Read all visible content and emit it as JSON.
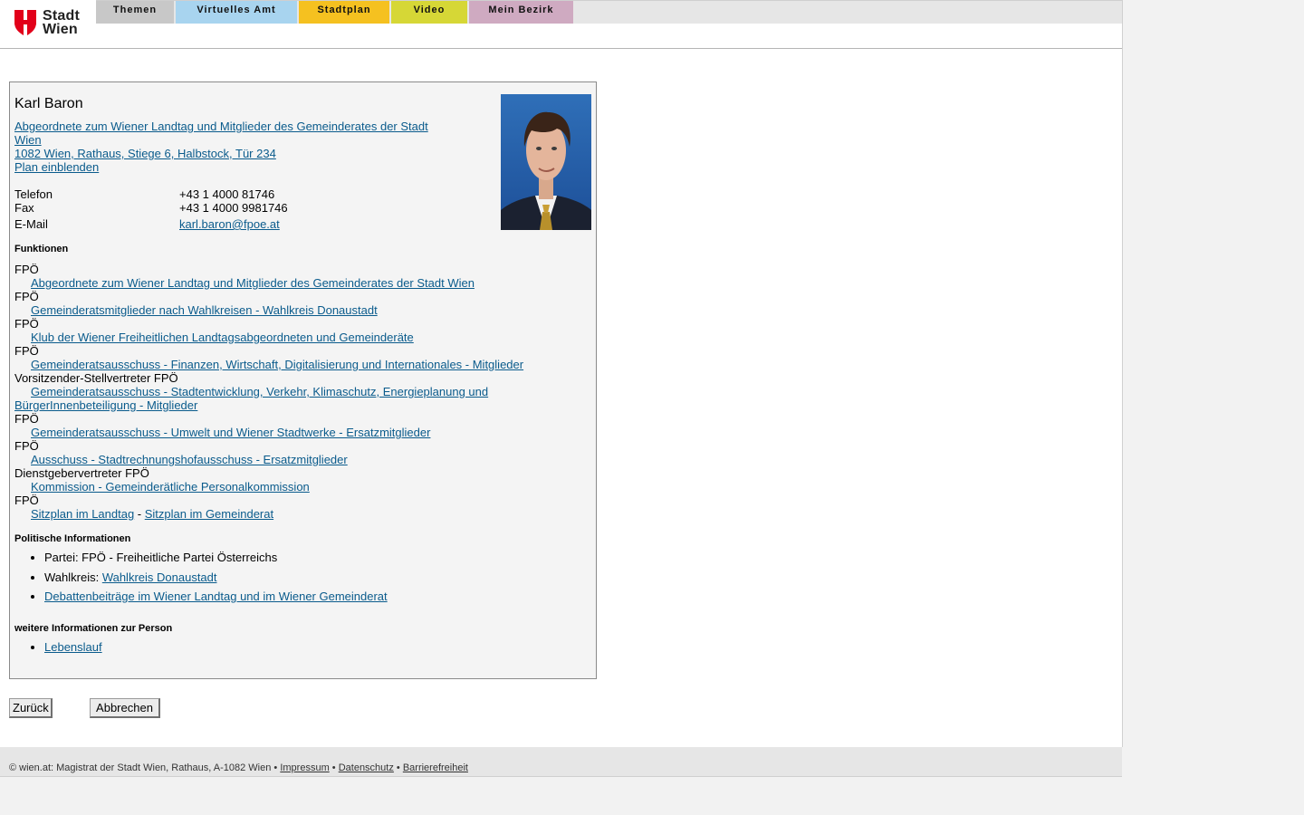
{
  "logo": {
    "line1": "Stadt",
    "line2": "Wien",
    "colors": {
      "red": "#e2001a"
    }
  },
  "nav": {
    "tabs": [
      {
        "label": "Themen",
        "color": "#c8c8c8"
      },
      {
        "label": "Virtuelles Amt",
        "color": "#a8d4ef"
      },
      {
        "label": "Stadtplan",
        "color": "#f5c120"
      },
      {
        "label": "Video",
        "color": "#d6d736"
      },
      {
        "label": "Mein Bezirk",
        "color": "#cfaac1"
      }
    ]
  },
  "person": {
    "name": "Karl Baron",
    "role_line1": "Abgeordnete zum Wiener Landtag und Mitglieder des Gemeinderates der Stadt",
    "role_line2": "Wien ",
    "address": "1082 Wien, Rathaus, Stiege 6, Halbstock, Tür 234",
    "plan": "Plan einblenden",
    "contact": [
      {
        "label": "Telefon",
        "value": "+43 1 4000 81746"
      },
      {
        "label": "Fax",
        "value": "+43 1 4000 9981746"
      },
      {
        "label": "E-Mail",
        "value": "karl.baron@fpoe.at"
      }
    ]
  },
  "funktionen": {
    "heading": "Funktionen",
    "items": [
      {
        "role": "FPÖ",
        "link": "Abgeordnete zum Wiener Landtag und Mitglieder des Gemeinderates der Stadt Wien"
      },
      {
        "role": "FPÖ",
        "link": "Gemeinderatsmitglieder nach Wahlkreisen - Wahlkreis Donaustadt"
      },
      {
        "role": "FPÖ",
        "link": "Klub der Wiener Freiheitlichen Landtagsabgeordneten und Gemeinderäte"
      },
      {
        "role": "FPÖ",
        "link": "Gemeinderatsausschuss - Finanzen, Wirtschaft, Digitalisierung und Internationales - Mitglieder"
      },
      {
        "role": "Vorsitzender-Stellvertreter FPÖ",
        "link_line1": "Gemeinderatsausschuss - Stadtentwicklung, Verkehr, Klimaschutz, Energieplanung und",
        "link_line2": "BürgerInnenbeteiligung - Mitglieder"
      },
      {
        "role": "FPÖ",
        "link": "Gemeinderatsausschuss - Umwelt und Wiener Stadtwerke - Ersatzmitglieder"
      },
      {
        "role": "FPÖ",
        "link": "Ausschuss - Stadtrechnungshofausschuss - Ersatzmitglieder"
      },
      {
        "role": "Dienstgebervertreter FPÖ",
        "link": "Kommission - Gemeinderätliche Personalkommission"
      },
      {
        "role": "FPÖ",
        "link_a": "Sitzplan im Landtag",
        "sep": " - ",
        "link_b": "Sitzplan im Gemeinderat"
      }
    ]
  },
  "politisch": {
    "heading": "Politische Informationen",
    "partei": "Partei: FPÖ - Freiheitliche Partei Österreichs",
    "wahlkreis_label": "Wahlkreis: ",
    "wahlkreis_link": "Wahlkreis Donaustadt",
    "debatten": "Debattenbeiträge im Wiener Landtag und im Wiener Gemeinderat"
  },
  "weitere": {
    "heading": "weitere Informationen zur Person",
    "lebenslauf": "Lebenslauf"
  },
  "buttons": {
    "back": "Zurück",
    "cancel": "Abbrechen"
  },
  "footer": {
    "copyright": "© wien.at: Magistrat der Stadt Wien, Rathaus, A-1082 Wien • ",
    "impressum": "Impressum",
    "bullet": " • ",
    "datenschutz": "Datenschutz",
    "barriere": "Barrierefreiheit"
  }
}
